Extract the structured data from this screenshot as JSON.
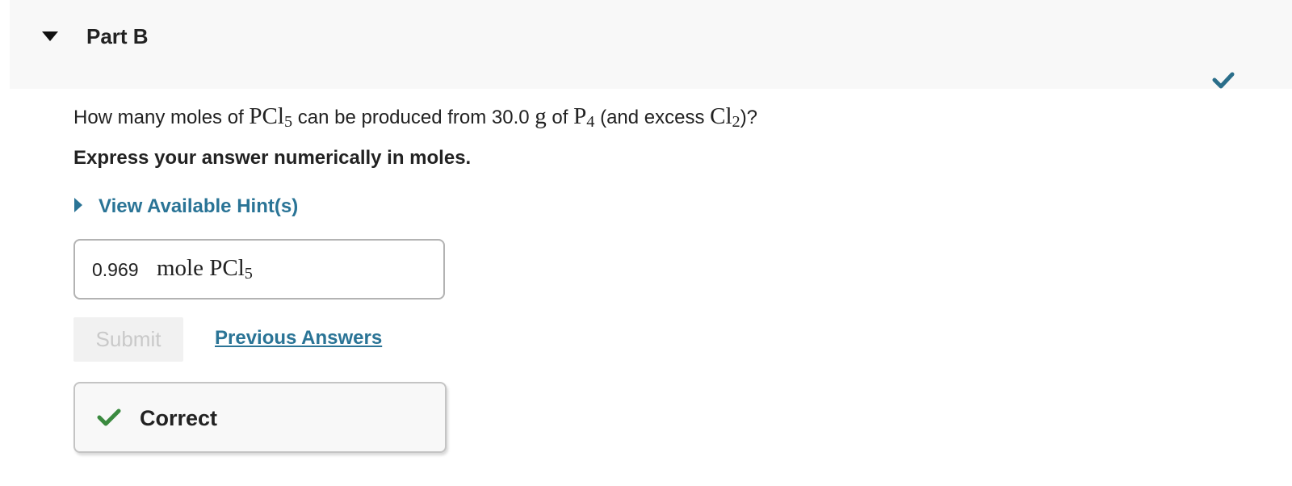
{
  "part": {
    "title": "Part B",
    "collapse_icon": "caret-down-icon",
    "status_icon": "checkmark-icon",
    "status_color": "#2a6e8a"
  },
  "question": {
    "prefix": "How many moles of ",
    "compound": "PCl",
    "compound_sub": "5",
    "middle_1": " can be produced from 30.0 ",
    "mass_unit": "g",
    "middle_2": " of ",
    "reactant": "P",
    "reactant_sub": "4",
    "middle_3": " (and excess ",
    "excess": "Cl",
    "excess_sub": "2",
    "suffix": ")?"
  },
  "instruction": "Express your answer numerically in moles.",
  "hint": {
    "label": "View Available Hint(s)",
    "icon": "caret-right-icon"
  },
  "answer": {
    "value": "0.969",
    "unit": "mole PCl",
    "unit_sub": "5"
  },
  "submit_label": "Submit",
  "previous_answers_label": "Previous Answers",
  "feedback": {
    "label": "Correct",
    "icon": "checkmark-icon",
    "icon_color": "#3a8a3f"
  },
  "colors": {
    "link": "#2a7496",
    "header_bg": "#f8f8f8",
    "text": "#222222"
  }
}
